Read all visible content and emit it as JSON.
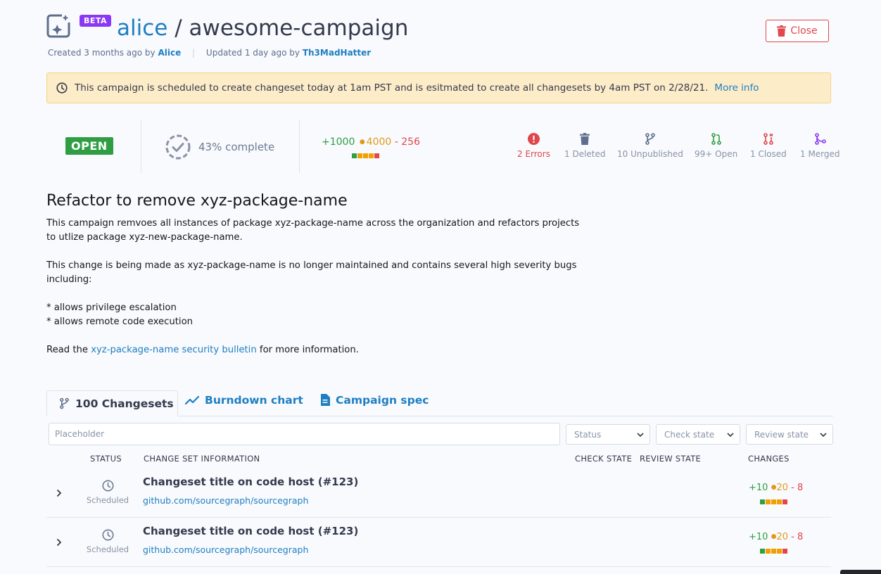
{
  "header": {
    "beta_label": "BETA",
    "namespace": "alice",
    "separator": " / ",
    "campaign_name": "awesome-campaign",
    "created_text": "Created 3 months ago by",
    "created_by": "Alice",
    "updated_text": "Updated 1 day ago by",
    "updated_by": "Th3MadHatter",
    "meta_separator": "|",
    "close_label": "Close"
  },
  "banner": {
    "message": "This campaign is scheduled to create changeset today at 1am PST and is esitmated to create all changesets by 4am PST on 2/28/21.",
    "link": "More info"
  },
  "stats": {
    "state": "OPEN",
    "progress_text": "43% complete",
    "progress_value": 43,
    "diff": {
      "added": "+1000",
      "changed": "4000",
      "deleted": "- 256"
    },
    "counts": [
      {
        "label": "2 Errors",
        "icon": "error-icon",
        "color": "#e0464b"
      },
      {
        "label": "1 Deleted",
        "icon": "trash-icon",
        "color": "#5e6e8c"
      },
      {
        "label": "10 Unpublished",
        "icon": "git-branch-icon",
        "color": "#5e6e8c"
      },
      {
        "label": "99+ Open",
        "icon": "pull-request-open-icon",
        "color": "#2f9e43"
      },
      {
        "label": "1 Closed",
        "icon": "pull-request-closed-icon",
        "color": "#e0464b"
      },
      {
        "label": "1 Merged",
        "icon": "merge-icon",
        "color": "#8a38f5"
      }
    ]
  },
  "description": {
    "title": "Refactor to remove xyz-package-name",
    "para1": "This campaign remvoes all instances of package xyz-package-name across the organization and refactors projects to utlize package xyz-new-package-name.",
    "para2": "This change is being made as xyz-package-name is no longer maintained and contains several high severity bugs including:",
    "bullet1": "* allows privilege escalation",
    "bullet2": "* allows remote code execution",
    "read_prefix": "Read the",
    "read_link": "xyz-package-name security bulletin",
    "read_suffix": "for more information."
  },
  "tabs": [
    {
      "label": "100 Changesets",
      "icon": "git-branch-icon"
    },
    {
      "label": "Burndown chart",
      "icon": "line-chart-icon"
    },
    {
      "label": "Campaign spec",
      "icon": "file-icon"
    }
  ],
  "filters": {
    "search_placeholder": "Placeholder",
    "status": "Status",
    "check_state": "Check state",
    "review_state": "Review state"
  },
  "table": {
    "headers": {
      "status": "STATUS",
      "info": "CHANGE SET INFORMATION",
      "check": "CHECK STATE",
      "review": "REVIEW STATE",
      "changes": "CHANGES"
    },
    "rows": [
      {
        "status": "Scheduled",
        "title": "Changeset title on code host (#123)",
        "repo": "github.com/sourcegraph/sourcegraph",
        "added": "+10",
        "changed": "20",
        "deleted": "- 8"
      },
      {
        "status": "Scheduled",
        "title": "Changeset title on code host (#123)",
        "repo": "github.com/sourcegraph/sourcegraph",
        "added": "+10",
        "changed": "20",
        "deleted": "- 8"
      }
    ]
  }
}
